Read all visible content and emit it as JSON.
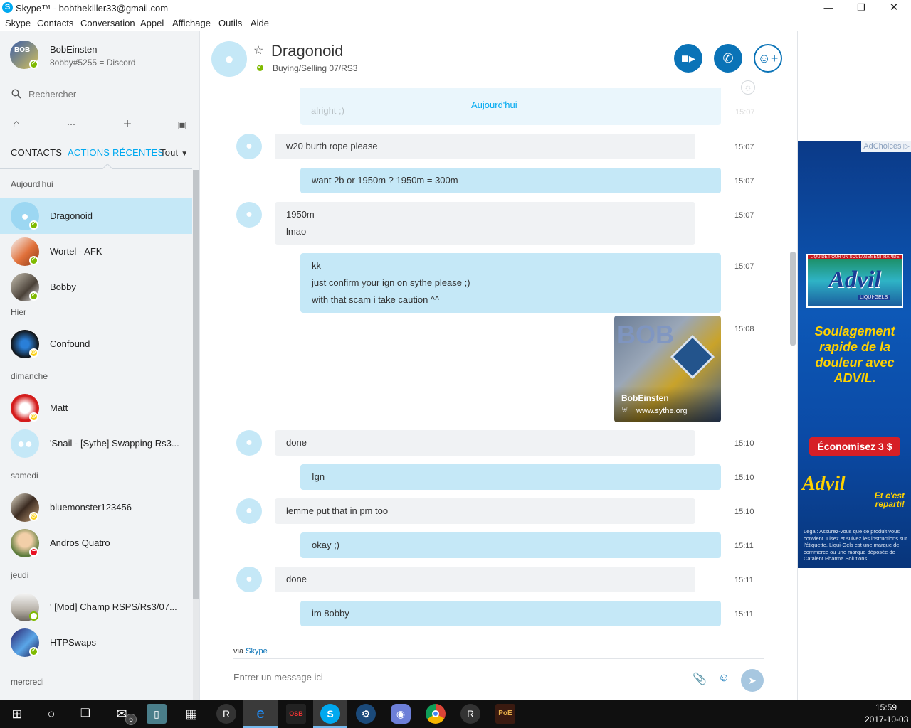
{
  "window": {
    "title": "Skype™ - bobthekiller33@gmail.com",
    "minimize_icon": "minimize-icon",
    "maximize_icon": "maximize-icon",
    "close_icon": "close-icon"
  },
  "menu": [
    "Skype",
    "Contacts",
    "Conversation",
    "Appel",
    "Affichage",
    "Outils",
    "Aide"
  ],
  "profile": {
    "name": "BobEinsten",
    "mood": "8obby#5255 = Discord",
    "status": "online"
  },
  "search": {
    "placeholder": "Rechercher"
  },
  "toolbar_icons": [
    "home-icon",
    "dialpad-icon",
    "add-icon",
    "bot-icon"
  ],
  "tabs": {
    "contacts": "CONTACTS",
    "recent": "ACTIONS RÉCENTES",
    "filter": "Tout"
  },
  "groups": [
    {
      "label": "Aujourd'hui"
    },
    {
      "label": "Hier"
    },
    {
      "label": "dimanche"
    },
    {
      "label": "samedi"
    },
    {
      "label": "jeudi"
    },
    {
      "label": "mercredi"
    }
  ],
  "contacts": [
    {
      "name": "Dragonoid",
      "status": "online",
      "selected": true
    },
    {
      "name": "Wortel - AFK",
      "status": "online"
    },
    {
      "name": "Bobby",
      "status": "online"
    },
    {
      "name": "Confound",
      "status": "away"
    },
    {
      "name": "Matt",
      "status": "away"
    },
    {
      "name": "'Snail - [Sythe] Swapping Rs3...",
      "status": "group"
    },
    {
      "name": "bluemonster123456",
      "status": "away"
    },
    {
      "name": "Andros Quatro",
      "status": "busy"
    },
    {
      "name": "' [Mod] Champ RSPS/Rs3/07...",
      "status": "offline"
    },
    {
      "name": "HTPSwaps",
      "status": "online"
    }
  ],
  "conversation": {
    "name": "Dragonoid",
    "mood": "Buying/Selling 07/RS3",
    "day_label": "Aujourd'hui",
    "partial_text": "alright ;)",
    "partial_time": "15:07",
    "messages": [
      {
        "dir": "in",
        "lines": [
          "w20 burth rope please"
        ],
        "time": "15:07"
      },
      {
        "dir": "out",
        "lines": [
          "want 2b or 1950m ? 1950m = 300m"
        ],
        "time": "15:07"
      },
      {
        "dir": "in",
        "lines": [
          "1950m",
          "lmao"
        ],
        "time": "15:07"
      },
      {
        "dir": "out",
        "lines": [
          "kk",
          "just confirm your ign on sythe please ;)",
          "with that scam i take caution ^^"
        ],
        "time": "15:07"
      },
      {
        "dir": "preview",
        "time": "15:08",
        "title": "BobEinsten",
        "url": "www.sythe.org"
      },
      {
        "dir": "in",
        "lines": [
          "done"
        ],
        "time": "15:10"
      },
      {
        "dir": "out",
        "lines": [
          "Ign"
        ],
        "time": "15:10"
      },
      {
        "dir": "in",
        "lines": [
          "lemme put that in pm too"
        ],
        "time": "15:10"
      },
      {
        "dir": "out",
        "lines": [
          "okay ;)"
        ],
        "time": "15:11"
      },
      {
        "dir": "in",
        "lines": [
          "done"
        ],
        "time": "15:11"
      },
      {
        "dir": "out",
        "lines": [
          "im 8obby"
        ],
        "time": "15:11"
      }
    ]
  },
  "composer": {
    "via_prefix": "via",
    "via_link": "Skype",
    "placeholder": "Entrer un message ici"
  },
  "ad": {
    "adchoices": "AdChoices",
    "box_top": "LIQUIDE POUR UN SOULAGEMENT RAPIDE",
    "brand": "Advil",
    "box_sub": "LIQUI-GELS",
    "headline": "Soulagement rapide de la douleur avec ADVIL.",
    "save": "Économisez 3 $",
    "tagline": "Et c'est reparti!",
    "legal": "Legal: Assurez-vous que ce produit vous convient. Lisez et suivez les instructions sur l'étiquette. Liqui-Gels est une marque de commerce ou une marque déposée de Catalent Pharma Solutions."
  },
  "taskbar": {
    "mail_badge": "6",
    "osb_label": "OSB",
    "pe_label": "PoE",
    "time": "15:59",
    "date": "2017-10-03"
  }
}
